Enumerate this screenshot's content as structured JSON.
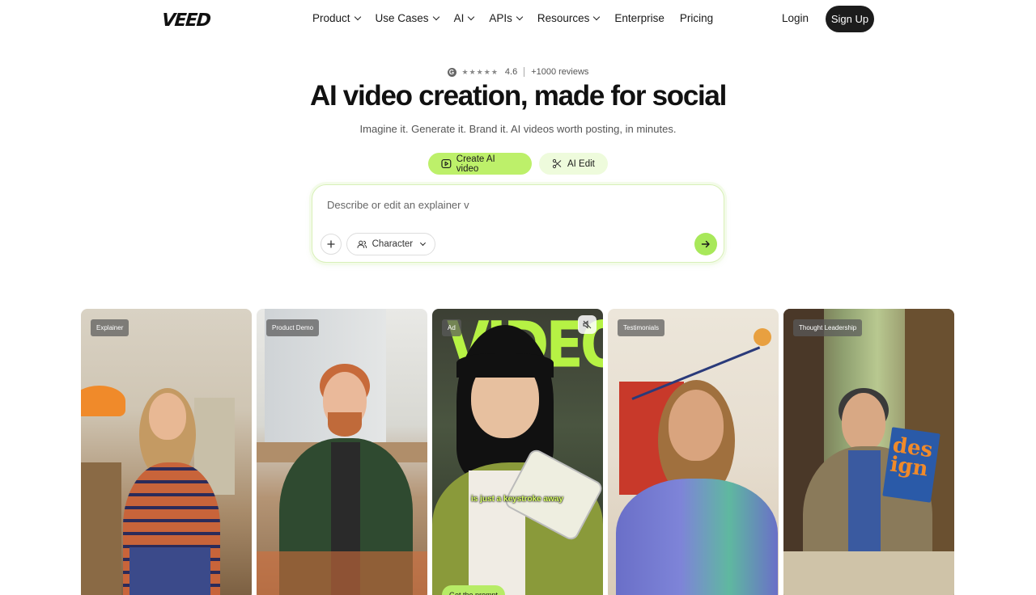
{
  "brand": {
    "logo_text": "VEED"
  },
  "nav": {
    "items": [
      {
        "label": "Product",
        "has_dropdown": true
      },
      {
        "label": "Use Cases",
        "has_dropdown": true
      },
      {
        "label": "AI",
        "has_dropdown": true
      },
      {
        "label": "APIs",
        "has_dropdown": true
      },
      {
        "label": "Resources",
        "has_dropdown": true
      },
      {
        "label": "Enterprise",
        "has_dropdown": false
      },
      {
        "label": "Pricing",
        "has_dropdown": false
      }
    ],
    "login_label": "Login",
    "signup_label": "Sign Up"
  },
  "hero": {
    "rating_value": "4.6",
    "reviews_text": "+1000 reviews",
    "stars": "★★★★★",
    "title": "AI video creation, made for social",
    "subtitle": "Imagine it. Generate it. Brand it. AI videos worth posting, in minutes."
  },
  "modes": {
    "create_label": "Create AI video",
    "edit_label": "AI Edit",
    "active": "create"
  },
  "prompt": {
    "value": "Describe or edit an explainer v",
    "character_label": "Character",
    "plus_icon": "plus-icon",
    "send_icon": "arrow-right-icon"
  },
  "cards": [
    {
      "tag": "Explainer"
    },
    {
      "tag": "Product Demo"
    },
    {
      "tag": "Ad",
      "overlay_word": "VIDEOS",
      "caption": "is just a keystroke away",
      "cta": "Get the prompt"
    },
    {
      "tag": "Testimonials"
    },
    {
      "tag": "Thought Leadership",
      "book_text": "des ign"
    }
  ],
  "colors": {
    "accent_green": "#bdf06a",
    "accent_light": "#eefbdc",
    "dark_button": "#1c1c1c"
  }
}
